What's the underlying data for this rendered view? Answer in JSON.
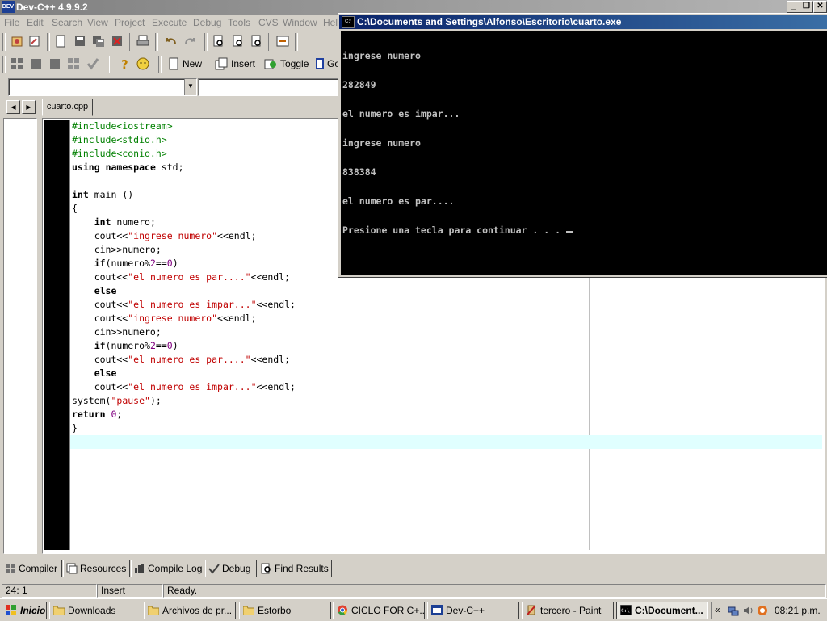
{
  "ide": {
    "title": "Dev-C++ 4.9.9.2",
    "icon_text": "DEV",
    "menu": [
      "File",
      "Edit",
      "Search",
      "View",
      "Project",
      "Execute",
      "Debug",
      "Tools",
      "CVS",
      "Window",
      "Help"
    ],
    "toolbar": {
      "new_label": "New",
      "insert_label": "Insert",
      "toggle_label": "Toggle",
      "goto_label": "Go"
    },
    "file_tab": "cuarto.cpp",
    "code_lines": [
      [
        [
          "pp",
          "#include<iostream>"
        ]
      ],
      [
        [
          "pp",
          "#include<stdio.h>"
        ]
      ],
      [
        [
          "pp",
          "#include<conio.h>"
        ]
      ],
      [
        [
          "kw",
          "using"
        ],
        [
          "sy",
          " "
        ],
        [
          "kw",
          "namespace"
        ],
        [
          "sy",
          " std;"
        ]
      ],
      [],
      [
        [
          "kw",
          "int"
        ],
        [
          "sy",
          " main ()"
        ]
      ],
      [
        [
          "sy",
          "{"
        ]
      ],
      [
        [
          "sy",
          "    "
        ],
        [
          "kw",
          "int"
        ],
        [
          "sy",
          " numero;"
        ]
      ],
      [
        [
          "sy",
          "    cout<<"
        ],
        [
          "st",
          "\"ingrese numero\""
        ],
        [
          "sy",
          "<<endl;"
        ]
      ],
      [
        [
          "sy",
          "    cin>>numero;"
        ]
      ],
      [
        [
          "sy",
          "    "
        ],
        [
          "kw",
          "if"
        ],
        [
          "sy",
          "(numero%"
        ],
        [
          "nm",
          "2"
        ],
        [
          "sy",
          "=="
        ],
        [
          "nm",
          "0"
        ],
        [
          "sy",
          ")"
        ]
      ],
      [
        [
          "sy",
          "    cout<<"
        ],
        [
          "st",
          "\"el numero es par....\""
        ],
        [
          "sy",
          "<<endl;"
        ]
      ],
      [
        [
          "sy",
          "    "
        ],
        [
          "kw",
          "else"
        ]
      ],
      [
        [
          "sy",
          "    cout<<"
        ],
        [
          "st",
          "\"el numero es impar...\""
        ],
        [
          "sy",
          "<<endl;"
        ]
      ],
      [
        [
          "sy",
          "    cout<<"
        ],
        [
          "st",
          "\"ingrese numero\""
        ],
        [
          "sy",
          "<<endl;"
        ]
      ],
      [
        [
          "sy",
          "    cin>>numero;"
        ]
      ],
      [
        [
          "sy",
          "    "
        ],
        [
          "kw",
          "if"
        ],
        [
          "sy",
          "(numero%"
        ],
        [
          "nm",
          "2"
        ],
        [
          "sy",
          "=="
        ],
        [
          "nm",
          "0"
        ],
        [
          "sy",
          ")"
        ]
      ],
      [
        [
          "sy",
          "    cout<<"
        ],
        [
          "st",
          "\"el numero es par....\""
        ],
        [
          "sy",
          "<<endl;"
        ]
      ],
      [
        [
          "sy",
          "    "
        ],
        [
          "kw",
          "else"
        ]
      ],
      [
        [
          "sy",
          "    cout<<"
        ],
        [
          "st",
          "\"el numero es impar...\""
        ],
        [
          "sy",
          "<<endl;"
        ]
      ],
      [
        [
          "sy",
          "system("
        ],
        [
          "st",
          "\"pause\""
        ],
        [
          "sy",
          ");"
        ]
      ],
      [
        [
          "kw",
          "return"
        ],
        [
          "sy",
          " "
        ],
        [
          "nm",
          "0"
        ],
        [
          "sy",
          ";"
        ]
      ],
      [
        [
          "sy",
          "}"
        ]
      ]
    ],
    "bottom_tabs": [
      "Compiler",
      "Resources",
      "Compile Log",
      "Debug",
      "Find Results"
    ],
    "status": {
      "position": "24: 1",
      "mode": "Insert",
      "message": "Ready."
    }
  },
  "console": {
    "title": "C:\\Documents and Settings\\Alfonso\\Escritorio\\cuarto.exe",
    "icon_text": "C:\\",
    "lines": [
      "ingrese numero",
      "282849",
      "el numero es impar...",
      "ingrese numero",
      "838384",
      "el numero es par....",
      "Presione una tecla para continuar . . . "
    ]
  },
  "taskbar": {
    "start_label": "Inicio",
    "tasks": [
      "Downloads",
      "Archivos de pr...",
      "Estorbo",
      "CICLO FOR C+...",
      "Dev-C++",
      "tercero - Paint",
      "C:\\Document..."
    ],
    "clock": "08:21 p.m.",
    "tray_chevron": "«"
  },
  "colors": {
    "keyword": "#000000",
    "preprocessor": "#008000",
    "string": "#c00000",
    "number": "#800080",
    "current_line": "#e0ffff",
    "console_title": "#0a246a"
  }
}
